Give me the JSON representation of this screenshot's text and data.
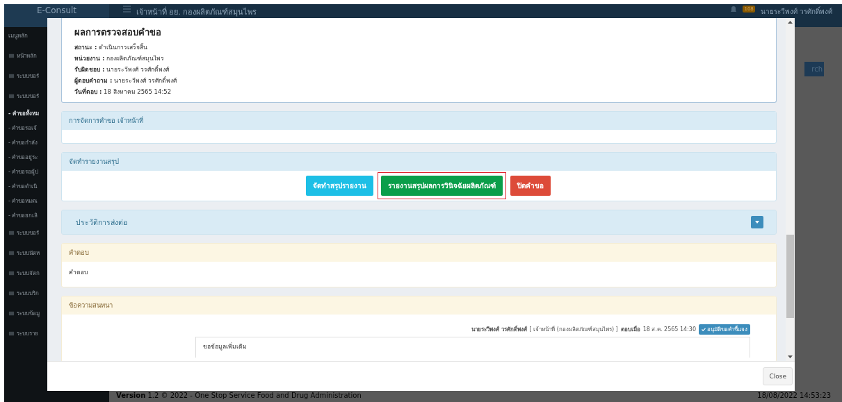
{
  "app": {
    "brand": "E-Consult",
    "header_title": "เจ้าหน้าที่ อย. กองผลิตภัณฑ์สมุนไพร",
    "notification_count": "108",
    "user": "นายระวีพงศ์ วรศักดิ์พงศ์",
    "search_button": "rch",
    "sidebar": {
      "heading": "เมนูหลัก",
      "items": [
        {
          "kind": "menu",
          "label": "หน้าหลัก",
          "selected": false
        },
        {
          "kind": "menu",
          "label": "ระบบขอรั",
          "selected": false
        },
        {
          "kind": "menu",
          "label": "ระบบขอรั",
          "selected": false
        },
        {
          "kind": "sub",
          "label": "- คำขอทั้งหม",
          "selected": true
        },
        {
          "kind": "sub",
          "label": "- คำขอรอเจ้",
          "selected": false
        },
        {
          "kind": "sub",
          "label": "- คำขอกำลัง",
          "selected": false
        },
        {
          "kind": "sub",
          "label": "- คำขออยู่ระ",
          "selected": false
        },
        {
          "kind": "sub",
          "label": "- คำขอรอผู้ป",
          "selected": false
        },
        {
          "kind": "sub",
          "label": "- คำขอดำเนิ",
          "selected": false
        },
        {
          "kind": "sub",
          "label": "- คำขอหมดเ",
          "selected": false
        },
        {
          "kind": "sub",
          "label": "- คำขอยกเลิ",
          "selected": false
        },
        {
          "kind": "menu",
          "label": "ระบบขอรั",
          "selected": false
        },
        {
          "kind": "menu",
          "label": "ระบบนัดห",
          "selected": false
        },
        {
          "kind": "menu",
          "label": "ระบบจัดก",
          "selected": false
        },
        {
          "kind": "menu",
          "label": "ระบบบริก",
          "selected": false
        },
        {
          "kind": "menu",
          "label": "ระบบข้อมู",
          "selected": false
        },
        {
          "kind": "menu",
          "label": "ระบบราย",
          "selected": false
        }
      ]
    },
    "footer": {
      "version_label": "Version",
      "version_text": "1.2 © 2022 - One Stop Service Food and Drug Administration",
      "datetime": "18/08/2022 14:53:23"
    }
  },
  "modal": {
    "result": {
      "title": "ผลการตรวจสอบคำขอ",
      "fields": [
        {
          "label": "สถานะ :",
          "value": "ดำเนินการเสร็จสิ้น"
        },
        {
          "label": "หน่วยงาน :",
          "value": "กองผลิตภัณฑ์สมุนไพร"
        },
        {
          "label": "รับผิดชอบ :",
          "value": "นายระวีพงศ์ วรศักดิ์พงศ์"
        },
        {
          "label": "ผู้ตอบคำถาม :",
          "value": "นายระวีพงศ์ วรศักดิ์พงศ์"
        },
        {
          "label": "วันที่ตอบ :",
          "value": "18 สิงหาคม 2565 14:52"
        }
      ]
    },
    "panels": [
      {
        "kind": "info",
        "title": "การจัดการคำขอ เจ้าหน้าที่"
      },
      {
        "kind": "actions",
        "title": "จัดทำรายงานสรุป",
        "buttons": [
          {
            "label": "จัดทำสรุปรายงาน",
            "kind": "info",
            "highlighted": false
          },
          {
            "label": "รายงานสรุปผลการวินิจฉัยผลิตภัณฑ์",
            "kind": "success",
            "highlighted": true
          },
          {
            "label": "ปิดคำขอ",
            "kind": "danger",
            "highlighted": false
          }
        ]
      },
      {
        "kind": "collapsible",
        "title": "ประวัติการส่งต่อ",
        "expanded": false
      },
      {
        "kind": "text",
        "title": "คำตอบ",
        "body": "คำตอบ"
      },
      {
        "kind": "chat",
        "title": "ข้อความสนทนา",
        "message": {
          "author": "นายระวีพงศ์ วรศักดิ์พงศ์",
          "role": "[ เจ้าหน้าที่ (กองผลิตภัณฑ์สมุนไพร) ]",
          "replied_label": "ตอบเมื่อ",
          "time": "18 ส.ค. 2565 14:30",
          "badge": "อนุมัติขอคำชี้แจง",
          "body": "ขอข้อมูลเพิ่มเติม"
        }
      }
    ],
    "close_label": "Close"
  }
}
